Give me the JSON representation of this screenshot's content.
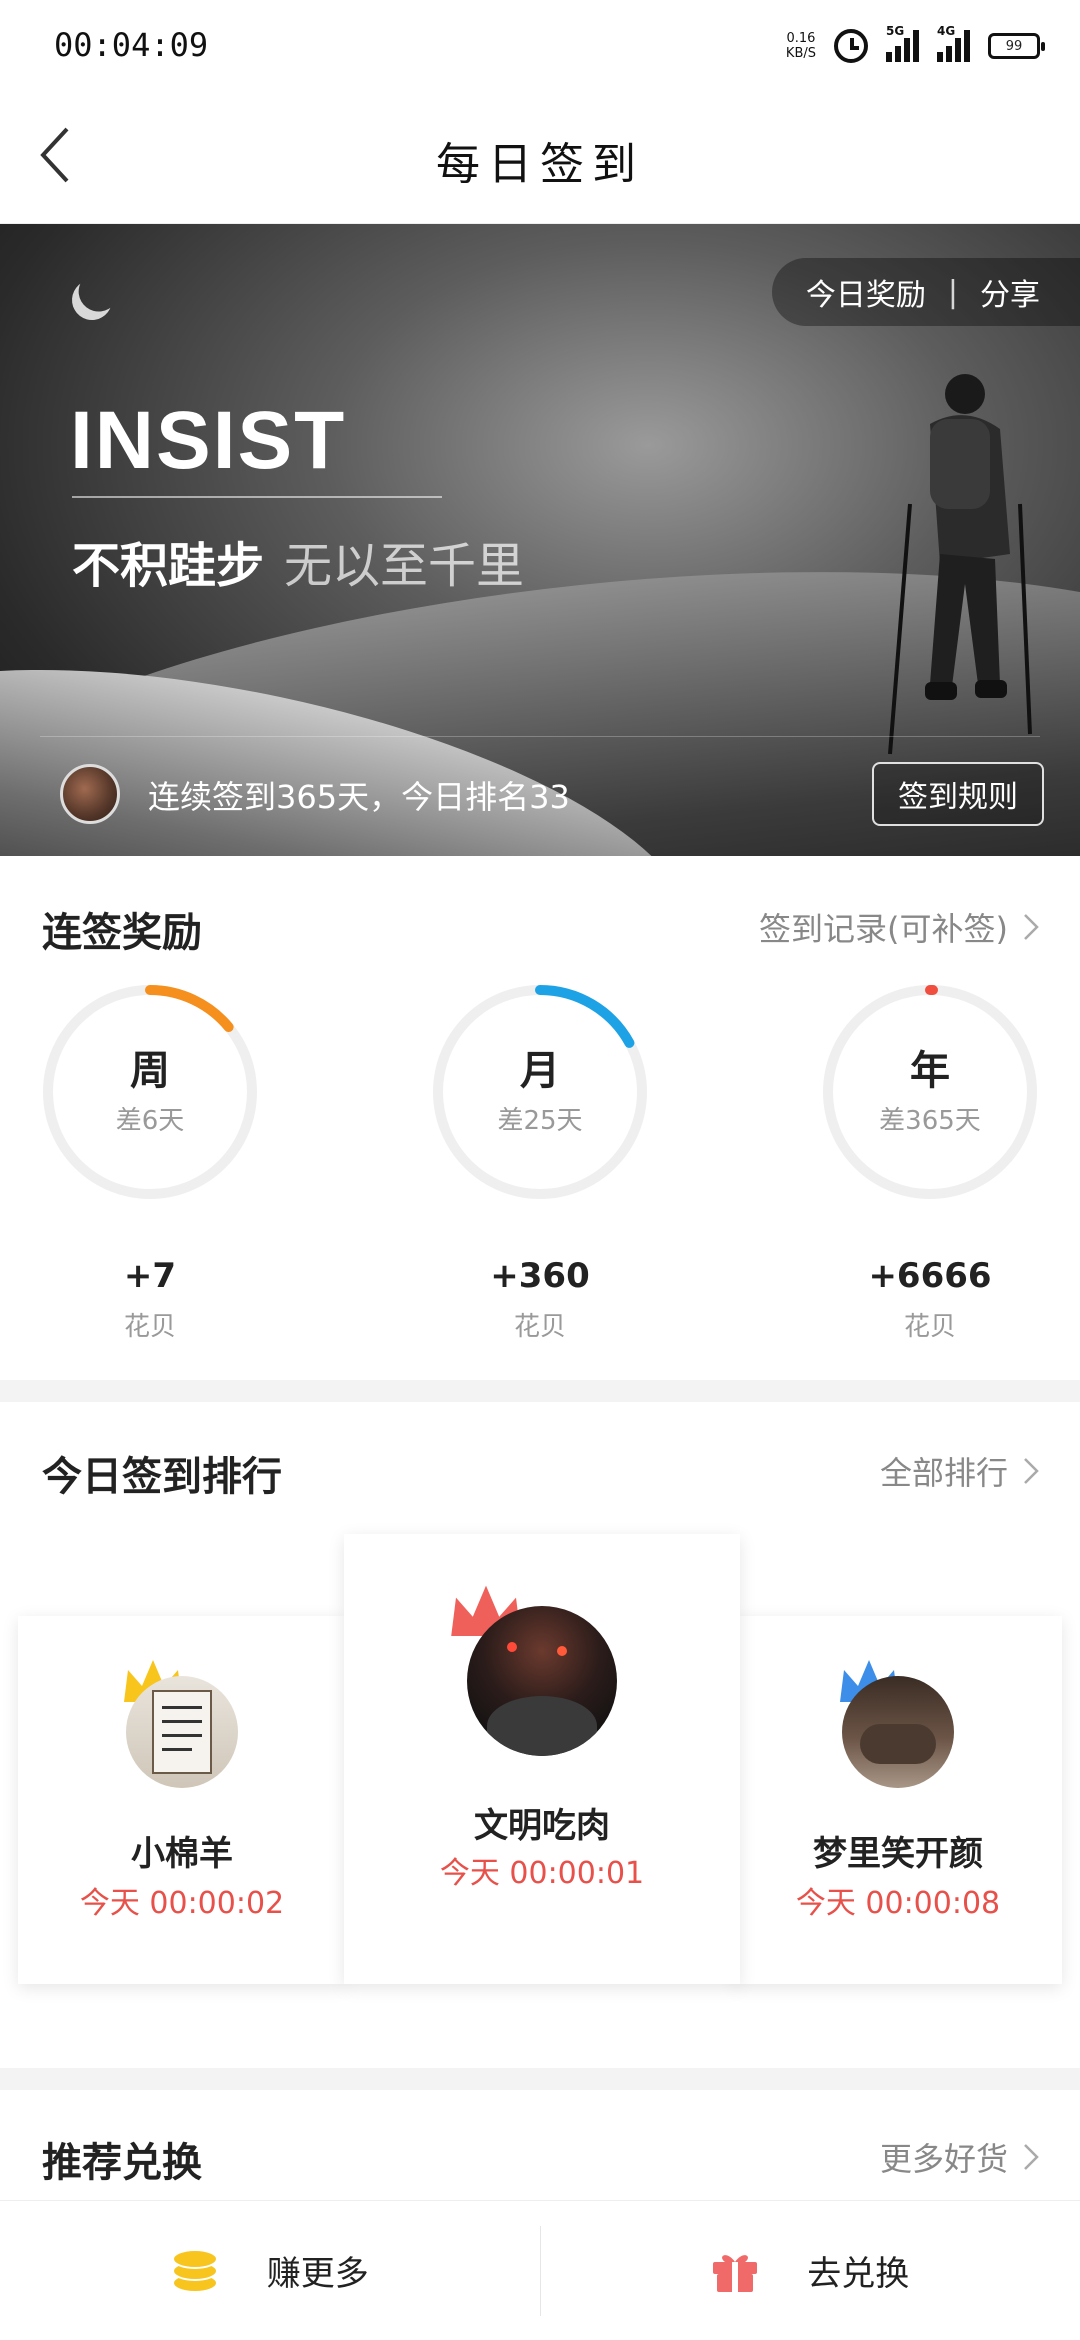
{
  "status_bar": {
    "time": "00:04:09",
    "net_speed": "0.16",
    "net_unit": "KB/S",
    "signal1_label": "5G",
    "signal2_label": "4G",
    "battery": "99"
  },
  "header": {
    "title": "每日签到",
    "back_icon": "chevron-left-icon"
  },
  "banner": {
    "headline": "INSIST",
    "slogan_part1": "不积跬步",
    "slogan_part2": "无以至千里",
    "today_reward": "今日奖励",
    "separator": "|",
    "share": "分享",
    "streak_text": "连续签到365天，今日排名33",
    "rules_button": "签到规则"
  },
  "rewards": {
    "title": "连签奖励",
    "record_link": "签到记录(可补签)",
    "items": [
      {
        "period": "周",
        "remaining": "差6天",
        "amount": "+7",
        "unit": "花贝",
        "color": "#f5901e",
        "progress": 0.14
      },
      {
        "period": "月",
        "remaining": "差25天",
        "amount": "+360",
        "unit": "花贝",
        "color": "#1ea2e6",
        "progress": 0.17
      },
      {
        "period": "年",
        "remaining": "差365天",
        "amount": "+6666",
        "unit": "花贝",
        "color": "#f04e3e",
        "progress": 0.0
      }
    ]
  },
  "ranking": {
    "title": "今日签到排行",
    "all_link": "全部排行",
    "entries": [
      {
        "name": "小棉羊",
        "time": "今天 00:00:02",
        "crown_color": "#f8c51c"
      },
      {
        "name": "文明吃肉",
        "time": "今天 00:00:01",
        "crown_color": "#f0605a"
      },
      {
        "name": "梦里笑开颜",
        "time": "今天 00:00:08",
        "crown_color": "#3d8ee8"
      }
    ]
  },
  "recommend": {
    "title": "推荐兑换",
    "more_link": "更多好货"
  },
  "bottom_bar": {
    "earn_more": "赚更多",
    "redeem": "去兑换",
    "coin_color": "#f7c51d",
    "gift_color": "#f06a6a"
  }
}
